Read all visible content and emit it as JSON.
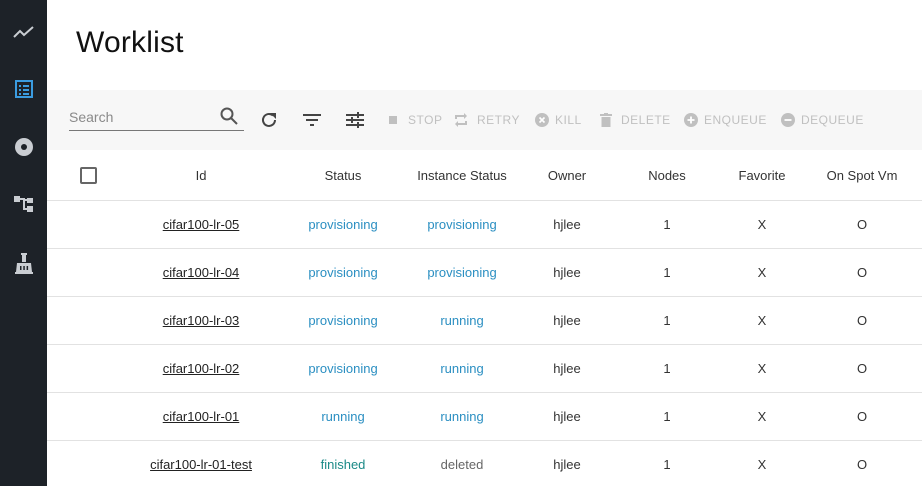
{
  "nav": [
    {
      "icon": "trending-up-icon",
      "active": false
    },
    {
      "icon": "list-icon",
      "active": true
    },
    {
      "icon": "disc-icon",
      "active": false
    },
    {
      "icon": "hierarchy-icon",
      "active": false
    },
    {
      "icon": "flask-icon",
      "active": false
    }
  ],
  "page": {
    "title": "Worklist"
  },
  "toolbar": {
    "search_placeholder": "Search",
    "search_value": "",
    "refresh_icon": "refresh-icon",
    "filter_icon": "filter-icon",
    "columns_icon": "tune-icon",
    "stop_label": "STOP",
    "retry_label": "RETRY",
    "kill_label": "KILL",
    "delete_label": "DELETE",
    "enqueue_label": "ENQUEUE",
    "dequeue_label": "DEQUEUE"
  },
  "table": {
    "columns": {
      "id": "Id",
      "status": "Status",
      "instance_status": "Instance Status",
      "owner": "Owner",
      "nodes": "Nodes",
      "favorite": "Favorite",
      "on_spot_vm": "On Spot Vm"
    },
    "rows": [
      {
        "id": "cifar100-lr-05",
        "status": "provisioning",
        "instance_status": "provisioning",
        "owner": "hjlee",
        "nodes": "1",
        "favorite": "X",
        "on_spot_vm": "O"
      },
      {
        "id": "cifar100-lr-04",
        "status": "provisioning",
        "instance_status": "provisioning",
        "owner": "hjlee",
        "nodes": "1",
        "favorite": "X",
        "on_spot_vm": "O"
      },
      {
        "id": "cifar100-lr-03",
        "status": "provisioning",
        "instance_status": "running",
        "owner": "hjlee",
        "nodes": "1",
        "favorite": "X",
        "on_spot_vm": "O"
      },
      {
        "id": "cifar100-lr-02",
        "status": "provisioning",
        "instance_status": "running",
        "owner": "hjlee",
        "nodes": "1",
        "favorite": "X",
        "on_spot_vm": "O"
      },
      {
        "id": "cifar100-lr-01",
        "status": "running",
        "instance_status": "running",
        "owner": "hjlee",
        "nodes": "1",
        "favorite": "X",
        "on_spot_vm": "O"
      },
      {
        "id": "cifar100-lr-01-test",
        "status": "finished",
        "instance_status": "deleted",
        "owner": "hjlee",
        "nodes": "1",
        "favorite": "X",
        "on_spot_vm": "O"
      }
    ]
  },
  "colors": {
    "sidebar_bg": "#1d2228",
    "nav_icon": "#c9cdd2",
    "nav_active": "#3b9ce0",
    "status_blue": "#2b8fc2",
    "status_teal": "#1b8a87",
    "disabled": "#c0c0c0"
  }
}
